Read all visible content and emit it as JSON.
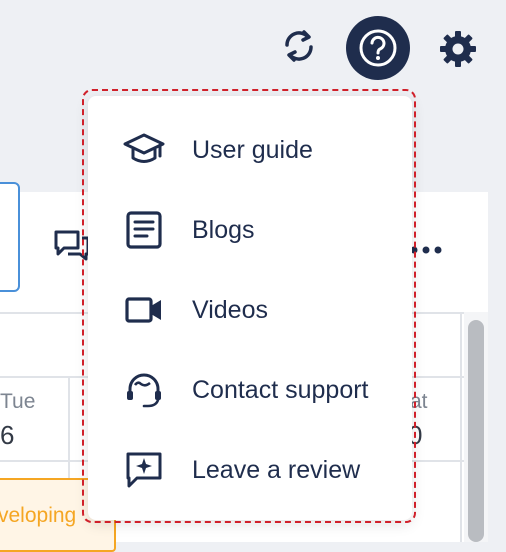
{
  "header": {
    "icons": [
      "sync-icon",
      "help-icon",
      "gear-icon"
    ]
  },
  "background": {
    "days": [
      {
        "name": "Tue",
        "num": "6"
      },
      {
        "name": "at",
        "num": "0"
      }
    ],
    "event_text": "veloping"
  },
  "menu": {
    "items": [
      {
        "label": "User guide",
        "icon": "graduation-cap-icon"
      },
      {
        "label": "Blogs",
        "icon": "document-icon"
      },
      {
        "label": "Videos",
        "icon": "video-camera-icon"
      },
      {
        "label": "Contact support",
        "icon": "headset-icon"
      },
      {
        "label": "Leave a review",
        "icon": "review-bubble-icon"
      }
    ]
  },
  "colors": {
    "navy": "#1f2d4d",
    "highlight_border": "#d0202a",
    "event_accent": "#f5a623",
    "input_border": "#4a90d9"
  }
}
